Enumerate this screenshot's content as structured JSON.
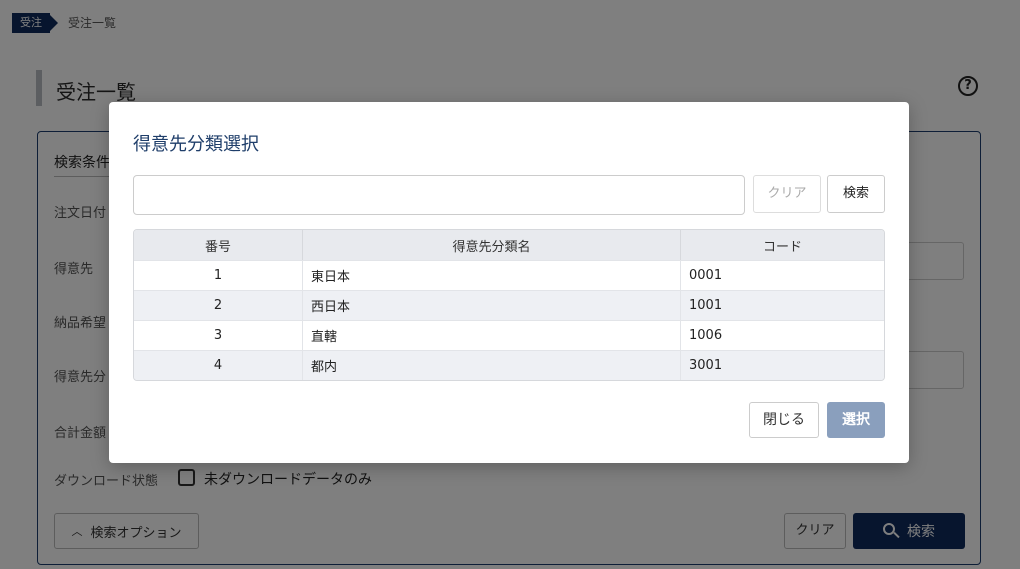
{
  "breadcrumb": {
    "tag": "受注",
    "current": "受注一覧"
  },
  "page": {
    "title": "受注一覧",
    "help_icon": "?"
  },
  "search_panel": {
    "heading": "検索条件",
    "rows": [
      {
        "label": "注文日付"
      },
      {
        "label": "得意先"
      },
      {
        "label": "納品希望"
      },
      {
        "label": "得意先分"
      },
      {
        "label": "合計金額"
      }
    ],
    "download_label": "ダウンロード状態",
    "download_checkbox_label": "未ダウンロードデータのみ",
    "options_button": "検索オプション",
    "clear_button": "クリア",
    "search_button": "検索"
  },
  "modal": {
    "title": "得意先分類選択",
    "input_value": "",
    "clear_button": "クリア",
    "search_button": "検索",
    "columns": [
      "番号",
      "得意先分類名",
      "コード"
    ],
    "rows": [
      {
        "no": "1",
        "name": "東日本",
        "code": "0001"
      },
      {
        "no": "2",
        "name": "西日本",
        "code": "1001"
      },
      {
        "no": "3",
        "name": "直轄",
        "code": "1006"
      },
      {
        "no": "4",
        "name": "都内",
        "code": "3001"
      }
    ],
    "close_button": "閉じる",
    "select_button": "選択"
  },
  "colors": {
    "navy": "#0e2a5c",
    "title_blue": "#1f3e6a",
    "select_disabled": "#8a9fbd"
  }
}
